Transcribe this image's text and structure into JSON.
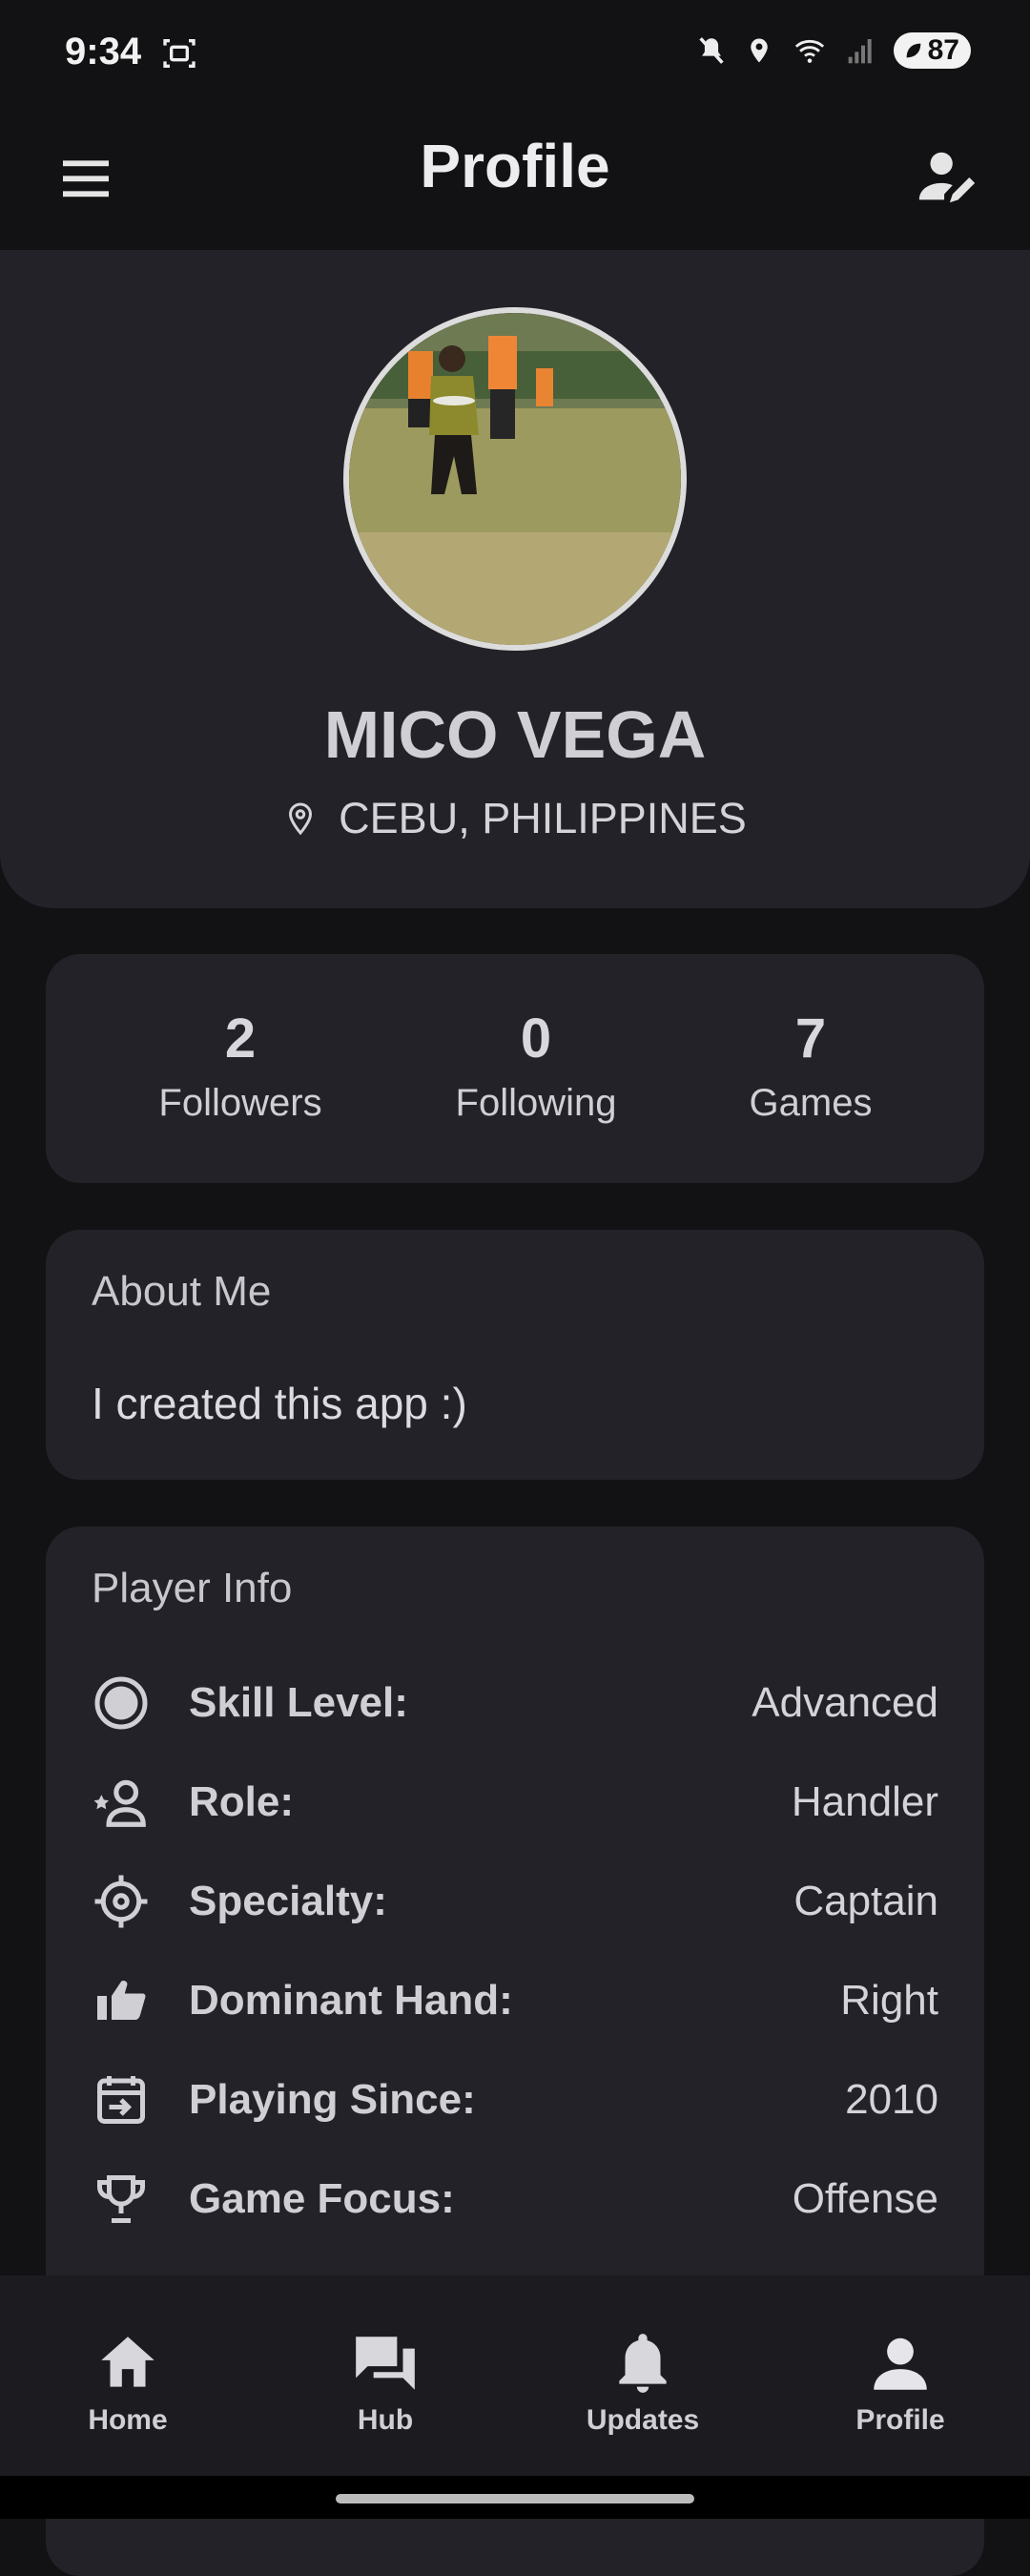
{
  "status_bar": {
    "time": "9:34",
    "battery": "87"
  },
  "app_bar": {
    "title": "Profile"
  },
  "profile": {
    "name": "MICO VEGA",
    "location": "CEBU, PHILIPPINES"
  },
  "stats": [
    {
      "value": "2",
      "label": "Followers"
    },
    {
      "value": "0",
      "label": "Following"
    },
    {
      "value": "7",
      "label": "Games"
    }
  ],
  "about": {
    "title": "About Me",
    "text": "I created this app :)"
  },
  "player_info": {
    "title": "Player Info",
    "rows": [
      {
        "icon": "skill-level-icon",
        "label": "Skill Level:",
        "value": "Advanced"
      },
      {
        "icon": "role-icon",
        "label": "Role:",
        "value": "Handler"
      },
      {
        "icon": "crosshair-icon",
        "label": "Specialty:",
        "value": "Captain"
      },
      {
        "icon": "thumb-hand-icon",
        "label": "Dominant Hand:",
        "value": "Right"
      },
      {
        "icon": "calendar-icon",
        "label": "Playing Since:",
        "value": "2010"
      },
      {
        "icon": "trophy-icon",
        "label": "Game Focus:",
        "value": "Offense"
      }
    ]
  },
  "bottom_nav": [
    {
      "icon": "home-icon",
      "label": "Home"
    },
    {
      "icon": "chat-icon",
      "label": "Hub"
    },
    {
      "icon": "bell-icon",
      "label": "Updates"
    },
    {
      "icon": "person-icon",
      "label": "Profile"
    }
  ],
  "colors": {
    "background": "#121214",
    "card": "#222228",
    "text": "#e6e6ea"
  }
}
